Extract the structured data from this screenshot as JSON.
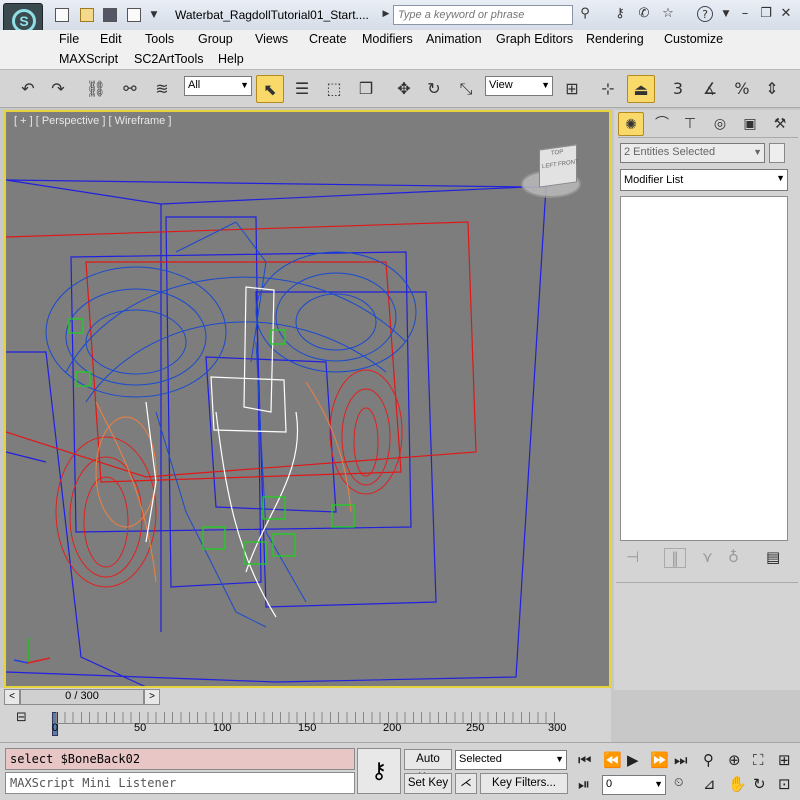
{
  "titlebar": {
    "title": "Waterbat_RagdollTutorial01_Start....",
    "search_placeholder": "Type a keyword or phrase"
  },
  "menubar": {
    "row1": [
      "File",
      "Edit",
      "Tools",
      "Group",
      "Views",
      "Create",
      "Modifiers",
      "Animation",
      "Graph Editors",
      "Rendering",
      "Customize"
    ],
    "row2": [
      "MAXScript",
      "SC2ArtTools",
      "Help"
    ]
  },
  "toolbar": {
    "selection_filter": "All",
    "coord_system": "View",
    "snap_labels": {
      "snap": "3",
      "angle": "",
      "percent": "%",
      "spinner": ""
    }
  },
  "viewport": {
    "label": "[ + ] [ Perspective ] [ Wireframe ]",
    "viewcube_top": "TOP",
    "viewcube_front": "FRONT",
    "viewcube_left": "LEFT"
  },
  "command_panel": {
    "selection_name": "2 Entities Selected",
    "modifier_list": "Modifier List"
  },
  "timeline": {
    "frame_label": "0 / 300",
    "ticks": [
      "0",
      "50",
      "100",
      "150",
      "200",
      "250",
      "300"
    ]
  },
  "bottom": {
    "maxscript_command": "select $BoneBack02",
    "maxscript_listener": "MAXScript Mini Listener",
    "auto_key": "Auto Key",
    "set_key": "Set Key",
    "key_mode": "Selected",
    "key_filters": "Key Filters...",
    "frame": "0"
  },
  "colors": {
    "selection": "#e6d23a",
    "active_tool": "#f8d96a",
    "viewport_bg": "#7d7d7d",
    "wire_blue": "#2020e0",
    "wire_red": "#e01818"
  }
}
